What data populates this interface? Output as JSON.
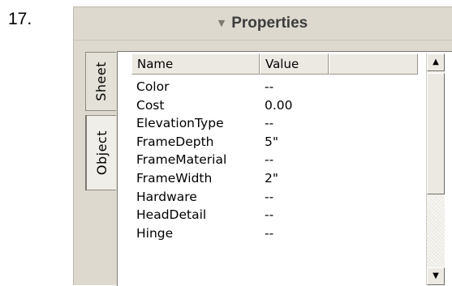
{
  "step": {
    "number": "17."
  },
  "panel": {
    "title": "Properties",
    "collapse_icon": "triangle-down-icon"
  },
  "tabs": [
    {
      "label": "Sheet",
      "active": false
    },
    {
      "label": "Object",
      "active": true
    }
  ],
  "grid": {
    "columns": [
      "Name",
      "Value",
      ""
    ],
    "rows": [
      {
        "name": "Color",
        "value": "--"
      },
      {
        "name": "Cost",
        "value": "0.00"
      },
      {
        "name": "ElevationType",
        "value": "--"
      },
      {
        "name": "FrameDepth",
        "value": "5\""
      },
      {
        "name": "FrameMaterial",
        "value": "--"
      },
      {
        "name": "FrameWidth",
        "value": "2\""
      },
      {
        "name": "Hardware",
        "value": "--"
      },
      {
        "name": "HeadDetail",
        "value": "--"
      },
      {
        "name": "Hinge",
        "value": "--"
      }
    ]
  },
  "scrollbar": {
    "up_icon": "arrow-up-icon",
    "down_icon": "arrow-down-icon"
  }
}
